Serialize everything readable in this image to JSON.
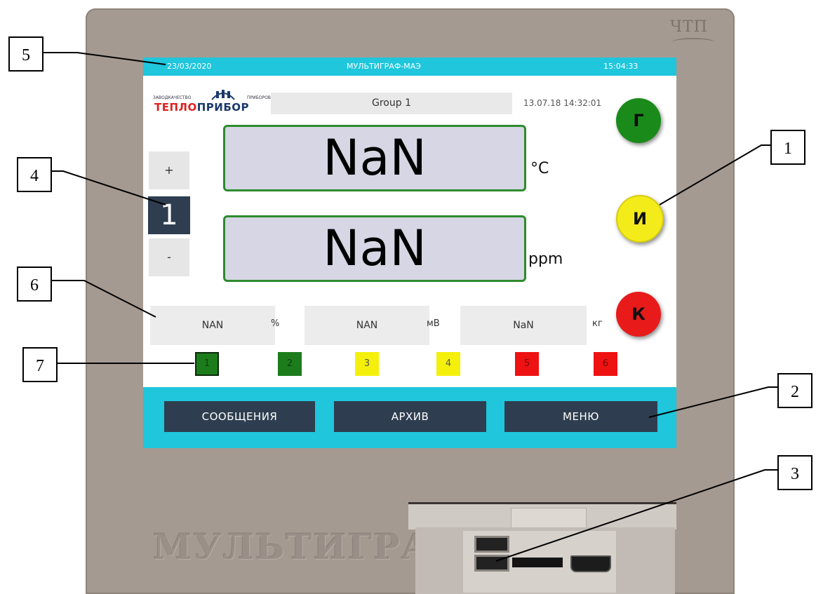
{
  "status_bar": {
    "date": "23/03/2020",
    "title": "МУЛЬТИГРАФ-МАЭ",
    "time": "15:04:33"
  },
  "logo": {
    "small_left": "ЗАВОДКАЧЕСТВО",
    "small_right": "ПРИБОРОВ",
    "main_left": "ТЕПЛО",
    "main_right": "ПРИБОР"
  },
  "header": {
    "group": "Group 1",
    "datetime": "13.07.18 14:32:01"
  },
  "channel": {
    "plus": "+",
    "number": "1",
    "minus": "-"
  },
  "values": {
    "primary": "NaN",
    "primary_unit": "°C",
    "secondary": "NaN",
    "secondary_unit": "ppm"
  },
  "params": [
    {
      "value": "NAN",
      "unit": "%"
    },
    {
      "value": "NAN",
      "unit": "мВ"
    },
    {
      "value": "NaN",
      "unit": "кг"
    }
  ],
  "indicators": {
    "g": "Г",
    "i": "И",
    "k": "К"
  },
  "relays": [
    "1",
    "2",
    "3",
    "4",
    "5",
    "6"
  ],
  "menu": {
    "messages": "СООБЩЕНИЯ",
    "archive": "АРХИВ",
    "menu": "МЕНЮ"
  },
  "device": {
    "brand_mark": "ЧТП",
    "engraving": "МУЛЬТИГРАФ"
  },
  "callouts": [
    "1",
    "2",
    "3",
    "4",
    "5",
    "6",
    "7"
  ],
  "colors": {
    "accent": "#1fc6dc",
    "button_dark": "#2e3e50",
    "panel_border": "#2e8b2e",
    "green": "#1a8a1a",
    "yellow": "#f4ec1a",
    "red": "#e81a1a"
  }
}
